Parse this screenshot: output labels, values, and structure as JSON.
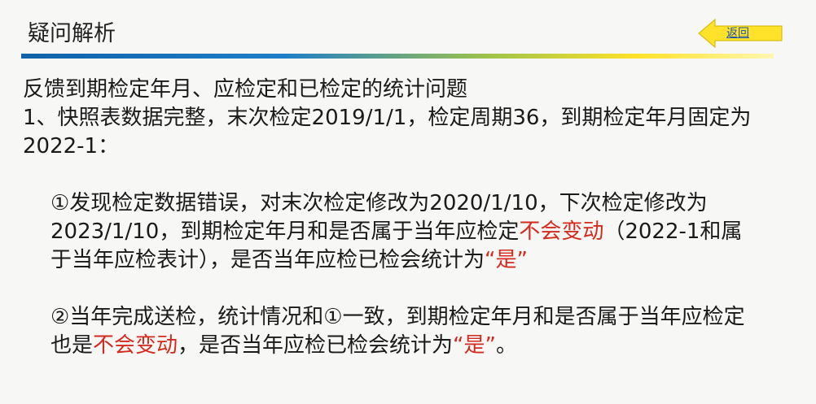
{
  "header": {
    "title": "疑问解析",
    "back_label": "返回"
  },
  "content": {
    "heading": "反馈到期检定年月、应检定和已检定的统计问题",
    "point1": "1、快照表数据完整，末次检定2019/1/1，检定周期36，到期检定年月固定为2022-1：",
    "sub1": {
      "before": "①发现检定数据错误，对末次检定修改为2020/1/10，下次检定修改为2023/1/10，到期检定年月和是否属于当年应检定",
      "highlight": "不会变动",
      "middle": "（2022-1和属于当年应检表计），是否当年应检已检会统计为",
      "quote": "“是”",
      "end": ""
    },
    "sub2": {
      "before": "②当年完成送检，统计情况和①一致，到期检定年月和是否属于当年应检定也是",
      "highlight": "不会变动",
      "middle": "，是否当年应检已检会统计为",
      "quote": "“是”",
      "end": "。"
    }
  },
  "colors": {
    "highlight": "#d42a1e",
    "arrow_fill": "#ffe229",
    "bar_start": "#0f63a8",
    "bar_end": "#ffe229"
  },
  "icons": {
    "back": "left-arrow-icon"
  }
}
